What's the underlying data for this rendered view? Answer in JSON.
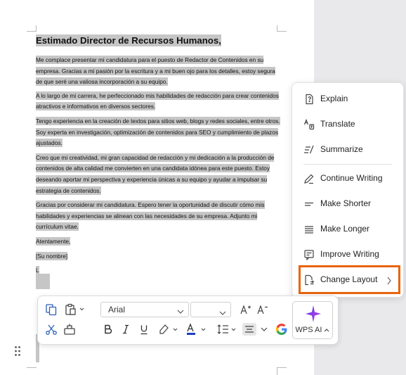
{
  "document": {
    "title": "Estimado Director de Recursos Humanos,",
    "paragraphs": [
      "Me complace presentar mi candidatura para el puesto de Redactor de Contenidos en su empresa. Gracias a mi pasión por la escritura y a mi buen ojo para los detalles, estoy segura de que seré una valiosa incorporación a su equipo.",
      "A lo largo de mi carrera, he perfeccionado mis habilidades de redacción para crear contenidos atractivos e informativos en diversos sectores.",
      "Tengo experiencia en la creación de textos para sitios web, blogs y redes sociales, entre otros. Soy experta en investigación, optimización de contenidos para SEO y cumplimiento de plazos ajustados.",
      "Creo que mi creatividad, mi gran capacidad de redacción y mi dedicación a la producción de contenidos de alta calidad me convierten en una candidata idónea para este puesto. Estoy deseando aportar mi perspectiva y experiencia únicas a su equipo y ayudar a impulsar su estrategia de contenidos.",
      "Gracias por considerar mi candidatura. Espero tener la oportunidad de discutir cómo mis habilidades y experiencias se alinean con las necesidades de su empresa. Adjunto mi currículum vitae."
    ],
    "closing": "Atentamente,",
    "signature": "[Su nombre]",
    "cursor_line": "L"
  },
  "toolbar": {
    "font_name": "Arial",
    "font_size": "",
    "wps_ai_label": "WPS AI",
    "colors": {
      "font_color_bar": "#1a3fbf",
      "highlight_bar": "#c0c0c0"
    }
  },
  "menu": {
    "items": [
      {
        "label": "Explain",
        "icon": "explain-icon"
      },
      {
        "label": "Translate",
        "icon": "translate-icon"
      },
      {
        "label": "Summarize",
        "icon": "summarize-icon"
      },
      {
        "label": "Continue Writing",
        "icon": "continue-writing-icon"
      },
      {
        "label": "Make Shorter",
        "icon": "make-shorter-icon"
      },
      {
        "label": "Make Longer",
        "icon": "make-longer-icon"
      },
      {
        "label": "Improve Writing",
        "icon": "improve-writing-icon"
      },
      {
        "label": "Change Layout",
        "icon": "change-layout-icon"
      }
    ],
    "highlight_color": "#e8640c"
  }
}
